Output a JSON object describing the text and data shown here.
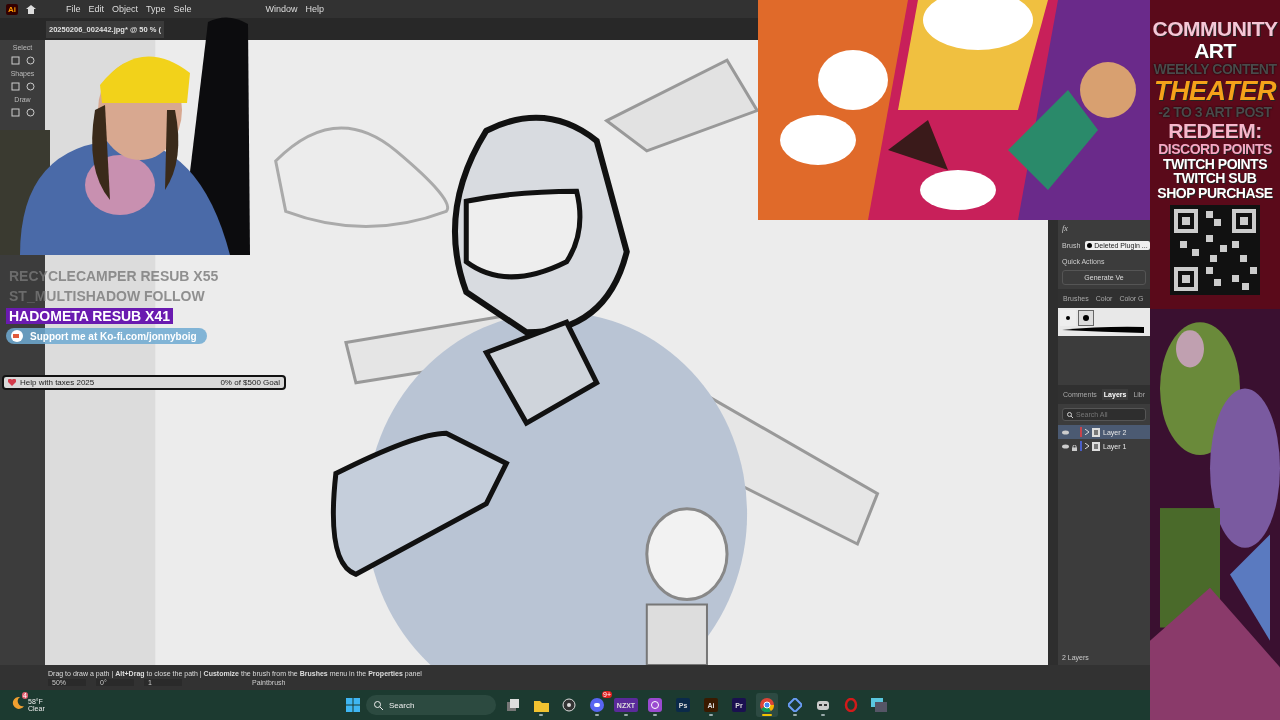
{
  "menu_bar": {
    "logo": "Ai",
    "items": [
      "File",
      "Edit",
      "Object",
      "Type",
      "Sele",
      "Window",
      "Help"
    ]
  },
  "document_tab": {
    "title": "20250206_002442.jpg* @ 50 % ("
  },
  "toolbar": {
    "sections": [
      "Select",
      "Shapes",
      "Draw"
    ]
  },
  "properties_panel": {
    "effects": "fx",
    "brush_label": "Brush",
    "brush_value": "Deleted Plugin ...",
    "quick_actions_label": "Quick Actions",
    "quick_action_button": "Generate Ve",
    "tabs": [
      "Brushes",
      "Color",
      "Color G"
    ],
    "brushes": [
      {
        "selected": false
      },
      {
        "selected": true
      }
    ]
  },
  "layers_panel": {
    "tabs": [
      {
        "label": "Comments",
        "selected": false
      },
      {
        "label": "Layers",
        "selected": true
      },
      {
        "label": "Libr",
        "selected": false
      }
    ],
    "search": {
      "placeholder": "Search All"
    },
    "layers": [
      {
        "name": "Layer 2",
        "selected": true,
        "locked": false,
        "color": "#c8434b"
      },
      {
        "name": "Layer 1",
        "selected": false,
        "locked": true,
        "color": "#4a5fc8"
      }
    ],
    "count": "2 Layers"
  },
  "status_bar": {
    "hint": "Drag to draw a path | **Alt+Drag** to close the path | **Customize** the brush from the **Brushes** menu in the **Properties** panel",
    "zoom": "50%",
    "rotation": "0°",
    "artboard": "1",
    "tool": "Paintbrush"
  },
  "stream_alerts": [
    {
      "text": "RECYCLECAMPER  RESUB X55",
      "highlighted": false
    },
    {
      "text": "ST_MULTISHADOW  FOLLOW",
      "highlighted": false
    },
    {
      "text": "HADOMETA  RESUB X41",
      "highlighted": true
    }
  ],
  "kofi_banner": {
    "text": "Support me at Ko-fi.com/jonnyboig"
  },
  "goal": {
    "title": "Help with taxes 2025",
    "progress": "0% of $500 Goal",
    "level": 0
  },
  "sidebar": {
    "lines": [
      {
        "text": "COMMUNITY",
        "kind": "title",
        "color": "#f6c6d6"
      },
      {
        "text": "ART",
        "kind": "title",
        "color": "#ffffff"
      },
      {
        "text": "WEEKLY CONTENT",
        "kind": "muted",
        "color": "#4a4a4a"
      },
      {
        "text": "THEATER",
        "kind": "feature",
        "color": "#f5a21a"
      },
      {
        "text": "-2 TO 3 ART POST",
        "kind": "muted",
        "color": "#4a4a4a"
      },
      {
        "text": "REDEEM:",
        "kind": "title",
        "color": "#f6b8cc"
      },
      {
        "text": "DISCORD POINTS",
        "kind": "item",
        "color": "#f6a8c4"
      },
      {
        "text": "TWITCH POINTS",
        "kind": "item",
        "color": "#ffffff"
      },
      {
        "text": "TWITCH SUB",
        "kind": "item",
        "color": "#ffffff"
      },
      {
        "text": "SHOP PURCHASE",
        "kind": "item",
        "color": "#ffffff"
      }
    ]
  },
  "taskbar": {
    "weather": {
      "temperature": "58°F",
      "condition": "Clear",
      "badge": "4"
    },
    "search": {
      "placeholder": "Search"
    },
    "apps": [
      {
        "kind": "task-view",
        "running": false,
        "selected": false
      },
      {
        "kind": "folder",
        "running": true,
        "selected": false
      },
      {
        "kind": "obs",
        "running": false,
        "selected": false
      },
      {
        "kind": "chat",
        "running": true,
        "selected": false,
        "badge": "9+"
      },
      {
        "kind": "label",
        "label": "NZXT",
        "color": "#5a2a9a",
        "running": true,
        "selected": false
      },
      {
        "kind": "camera",
        "running": true,
        "selected": false
      },
      {
        "kind": "label",
        "label": "Ps",
        "color": "#0b2a4a",
        "running": false,
        "selected": false
      },
      {
        "kind": "label",
        "label": "Ai",
        "color": "#3a1a00",
        "running": true,
        "selected": false
      },
      {
        "kind": "label",
        "label": "Pr",
        "color": "#1a1050",
        "running": false,
        "selected": false
      },
      {
        "kind": "browser",
        "running": true,
        "selected": true
      },
      {
        "kind": "diamond",
        "running": true,
        "selected": false
      },
      {
        "kind": "robot",
        "running": true,
        "selected": false
      },
      {
        "kind": "ring",
        "running": false,
        "selected": false
      },
      {
        "kind": "window",
        "running": false,
        "selected": false
      }
    ]
  }
}
